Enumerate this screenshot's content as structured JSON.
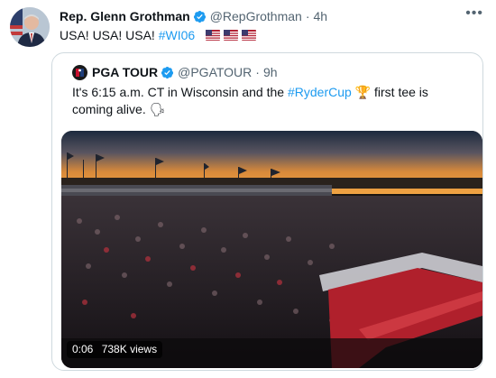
{
  "tweet": {
    "author_name": "Rep. Glenn Grothman",
    "handle": "@RepGrothman",
    "separator": "·",
    "time": "4h",
    "more_label": "•••",
    "text": "USA! USA! USA! ",
    "hashtag": "#WI06",
    "flag_emoji": "🇺🇸🇺🇸🇺🇸"
  },
  "quote": {
    "author_name": "PGA TOUR",
    "handle": "@PGATOUR",
    "separator": "·",
    "time": "9h",
    "text_before": "It's 6:15 a.m. CT in Wisconsin and the ",
    "hashtag": "#RyderCup",
    "trophy_emoji": "🏆",
    "text_after": " first tee is coming alive. ",
    "megaphone_emoji": "🗣"
  },
  "media": {
    "duration": "0:06",
    "views": "738K views"
  },
  "colors": {
    "link": "#1d9bf0",
    "verified": "#1d9bf0",
    "muted": "#536471",
    "border": "#cfd9de"
  },
  "icons": {
    "verified": "verified-badge-icon",
    "more": "more-options-icon",
    "flag": "us-flag-icon",
    "trophy": "trophy-icon",
    "megaphone": "speaking-head-icon"
  }
}
